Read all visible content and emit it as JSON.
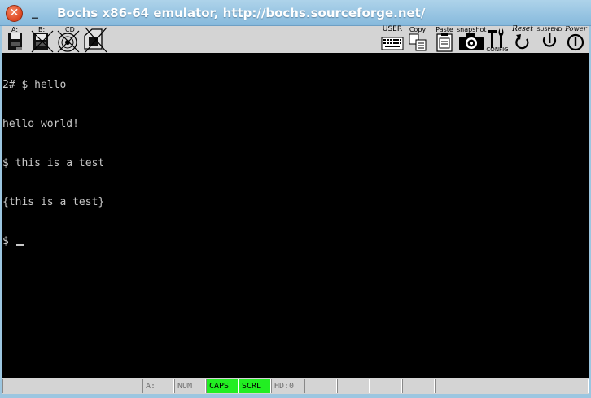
{
  "window": {
    "title": "Bochs x86-64 emulator, http://bochs.sourceforge.net/",
    "close_glyph": "✕",
    "minimize_glyph": "_"
  },
  "toolbar": {
    "floppy_a_label": "A:",
    "floppy_b_label": "B:",
    "cdrom_label": "CD",
    "user_label": "USER",
    "copy_label": "Copy",
    "paste_label": "Paste",
    "snapshot_label": "snapshot",
    "config_label": "CONFIG",
    "reset_label": "Reset",
    "suspend_label": "SUSPEND",
    "power_label": "Power"
  },
  "terminal": {
    "lines": [
      "2# $ hello",
      "hello world!",
      "$ this is a test",
      "{this is a test}",
      "$ "
    ],
    "text_color": "#c8c8c8",
    "background": "#000000"
  },
  "statusbar": {
    "cells": [
      "",
      "A:",
      "NUM",
      "CAPS",
      "SCRL",
      "HD:0",
      "",
      "",
      "",
      "",
      ""
    ],
    "active_color": "#22ee22"
  }
}
